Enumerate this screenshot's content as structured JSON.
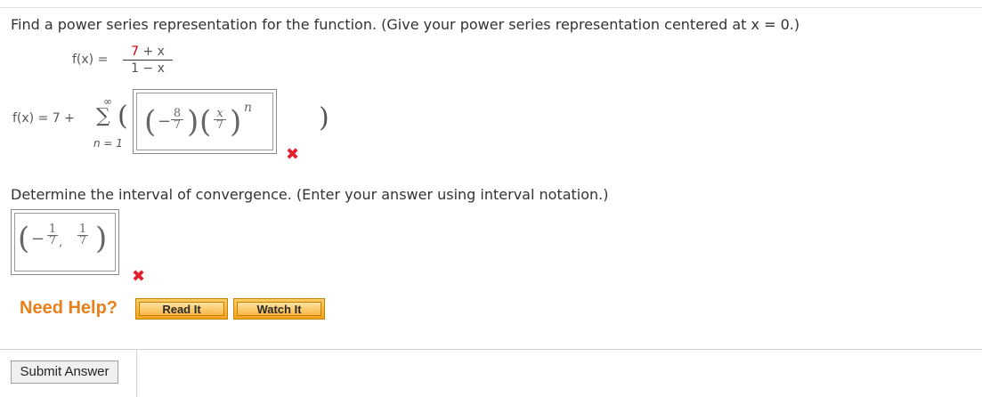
{
  "question": {
    "prompt": "Find a power series representation for the function. (Give your power series representation centered at x = 0.)",
    "function_lhs": "f(x)",
    "eq": "=",
    "numerator_left": "7",
    "numerator_op": "+ x",
    "denominator": "1 − x"
  },
  "series": {
    "lhs": "f(x) = 7 +",
    "sum_upper": "∞",
    "sum_lower": "n = 1",
    "open_paren": "(",
    "close_paren": ")",
    "answer": {
      "minus": "−",
      "frac1_num": "8",
      "frac1_den": "7",
      "frac2_num": "x",
      "frac2_den": "7",
      "exponent": "n"
    },
    "status": "incorrect"
  },
  "interval": {
    "prompt": "Determine the interval of convergence. (Enter your answer using interval notation.)",
    "answer": {
      "open": "(",
      "minus": "−",
      "a_num": "1",
      "a_den": "7",
      "comma": ",",
      "b_num": "1",
      "b_den": "7",
      "close": ")"
    },
    "status": "incorrect"
  },
  "help": {
    "label": "Need Help?",
    "read_it": "Read It",
    "watch_it": "Watch It"
  },
  "submit_label": "Submit Answer",
  "icons": {
    "wrong": "x-mark-icon"
  },
  "colors": {
    "wrong": "#e0202c",
    "help": "#e8801b",
    "numerator_highlight": "#d40000"
  }
}
